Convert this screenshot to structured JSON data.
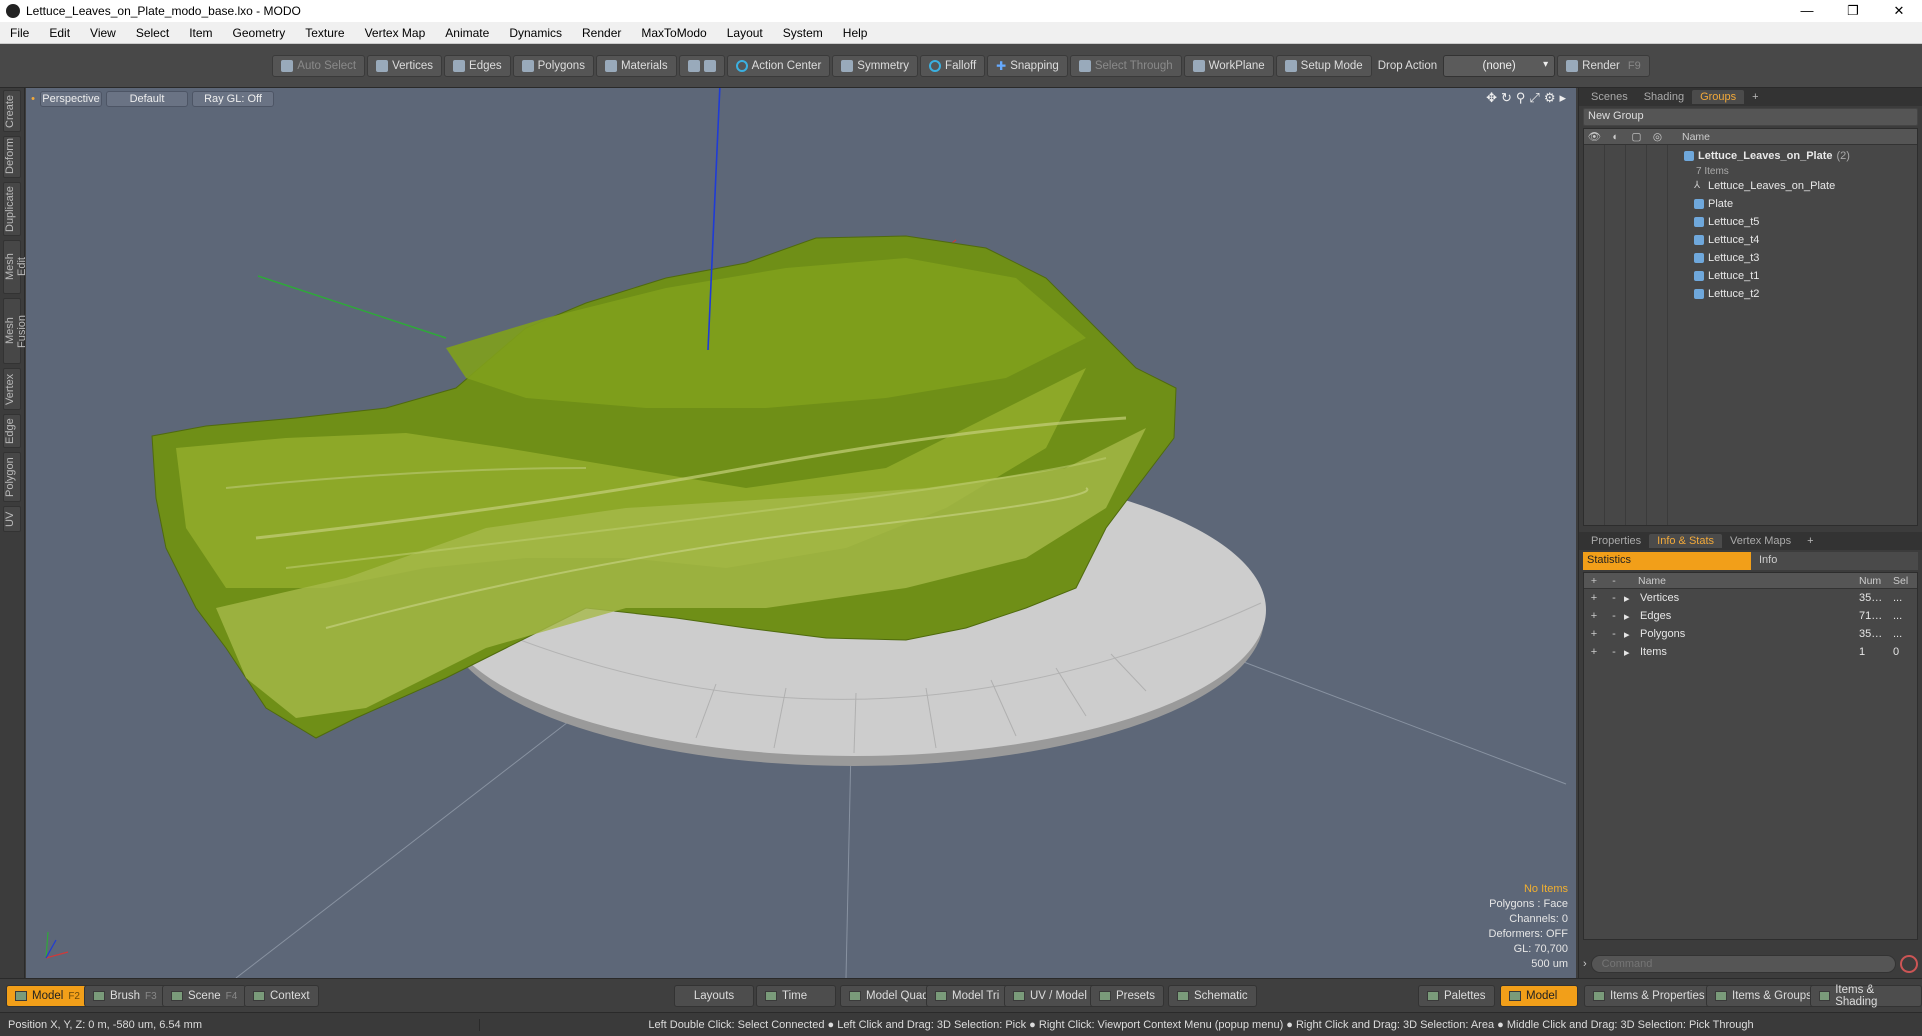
{
  "window": {
    "title": "Lettuce_Leaves_on_Plate_modo_base.lxo - MODO",
    "controls": [
      "—",
      "❐",
      "✕"
    ]
  },
  "menu": [
    "File",
    "Edit",
    "View",
    "Select",
    "Item",
    "Geometry",
    "Texture",
    "Vertex Map",
    "Animate",
    "Dynamics",
    "Render",
    "MaxToModo",
    "Layout",
    "System",
    "Help"
  ],
  "toolbar": {
    "auto_select": "Auto Select",
    "vertices": "Vertices",
    "edges": "Edges",
    "polygons": "Polygons",
    "materials": "Materials",
    "action_center": "Action Center",
    "symmetry": "Symmetry",
    "falloff": "Falloff",
    "snapping": "Snapping",
    "select_through": "Select Through",
    "workplane": "WorkPlane",
    "setup_mode": "Setup Mode",
    "drop_action_label": "Drop Action",
    "drop_action_value": "(none)",
    "render": "Render",
    "render_key": "F9"
  },
  "left_tabs": [
    "Create",
    "Deform",
    "Duplicate",
    "Mesh Edit",
    "Mesh Fusion",
    "Vertex",
    "Edge",
    "Polygon",
    "UV"
  ],
  "viewport": {
    "view": "Perspective",
    "shading": "Default",
    "raygl": "Ray GL: Off",
    "stats": {
      "no_items": "No Items",
      "polygons": "Polygons : Face",
      "channels": "Channels: 0",
      "deformers": "Deformers: OFF",
      "gl": "GL: 70,700",
      "scale": "500 um"
    }
  },
  "groups_panel": {
    "tabs": [
      "Scenes",
      "Shading",
      "Groups"
    ],
    "active_tab": "Groups",
    "new_group": "New Group",
    "col_name": "Name",
    "root": "Lettuce_Leaves_on_Plate",
    "root_count": "(2)",
    "root_sub": "7 Items",
    "items": [
      "Lettuce_Leaves_on_Plate",
      "Plate",
      "Lettuce_t5",
      "Lettuce_t4",
      "Lettuce_t3",
      "Lettuce_t1",
      "Lettuce_t2"
    ]
  },
  "info_panel": {
    "tabs": [
      "Properties",
      "Info & Stats",
      "Vertex Maps"
    ],
    "active_tab": "Info & Stats",
    "stat_tabs": [
      "Statistics",
      "Info"
    ],
    "cols": {
      "name": "Name",
      "num": "Num",
      "sel": "Sel"
    },
    "rows": [
      {
        "name": "Vertices",
        "num": "35…",
        "sel": "..."
      },
      {
        "name": "Edges",
        "num": "71…",
        "sel": "..."
      },
      {
        "name": "Polygons",
        "num": "35…",
        "sel": "..."
      },
      {
        "name": "Items",
        "num": "1",
        "sel": "0"
      }
    ],
    "command_placeholder": "Command"
  },
  "bottom": {
    "model": "Model",
    "model_key": "F2",
    "brush": "Brush",
    "brush_key": "F3",
    "scene": "Scene",
    "scene_key": "F4",
    "context": "Context",
    "layouts": "Layouts",
    "time": "Time",
    "model_quad": "Model Quad",
    "model_tri": "Model Tri",
    "uv_model": "UV / Model",
    "presets": "Presets",
    "schematic": "Schematic",
    "palettes": "Palettes",
    "model_right": "Model",
    "items_properties": "Items & Properties",
    "items_groups": "Items & Groups",
    "items_shading": "Items & Shading"
  },
  "status": {
    "position": "Position X, Y, Z:   0 m, -580 um, 6.54 mm",
    "hint": "Left Double Click: Select Connected ● Left Click and Drag: 3D Selection: Pick ● Right Click: Viewport Context Menu (popup menu) ● Right Click and Drag: 3D Selection: Area ● Middle Click and Drag: 3D Selection: Pick Through"
  },
  "colors": {
    "viewport_bg": "#5d6778",
    "lettuce": "#7a9a1a",
    "plate": "#c8c8c8",
    "accent": "#f29f19"
  }
}
